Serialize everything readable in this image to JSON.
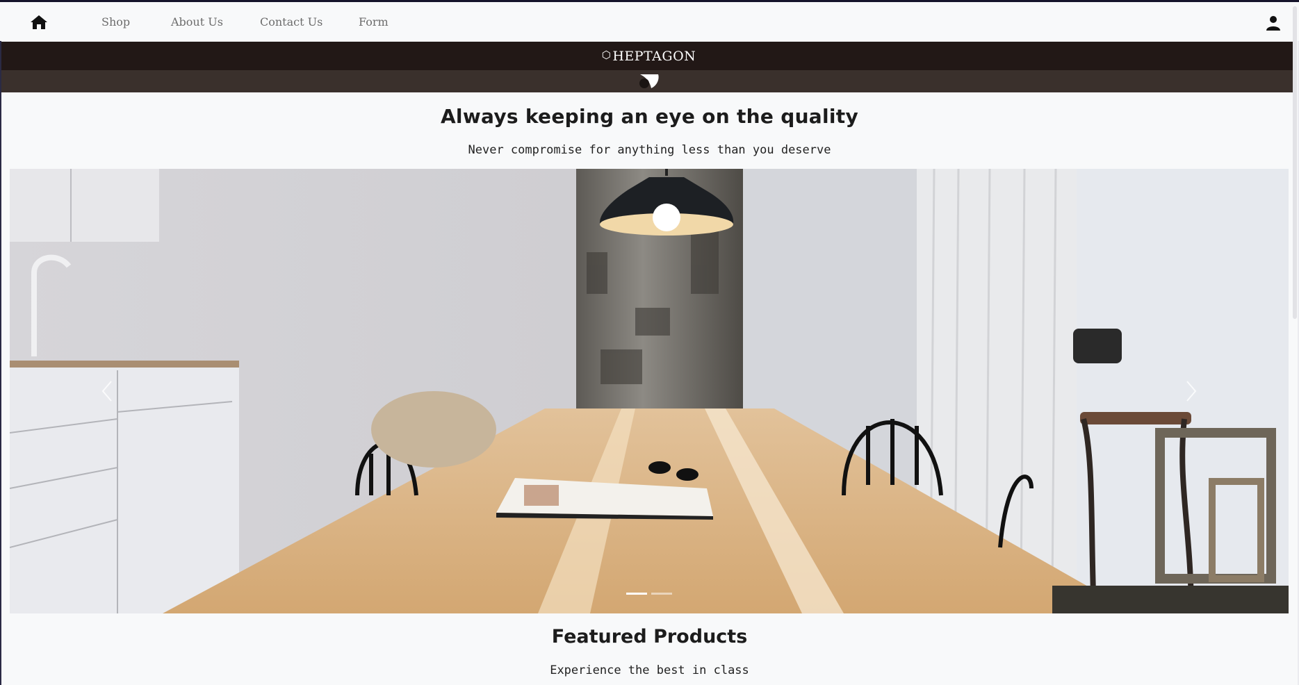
{
  "nav": {
    "links": [
      "Shop",
      "About Us",
      "Contact Us",
      "Form"
    ],
    "home_icon": "home-icon",
    "user_icon": "user-icon"
  },
  "brand": {
    "name": "HEPTAGON",
    "icon": "⬡"
  },
  "hero": {
    "title": "Always keeping an eye on the quality",
    "subtitle": "Never compromise for anything less than you deserve"
  },
  "carousel": {
    "slides": 2,
    "active_index": 0,
    "prev_icon": "chevron-left-icon",
    "next_icon": "chevron-right-icon"
  },
  "featured": {
    "title": "Featured Products",
    "subtitle": "Experience the best in class"
  },
  "colors": {
    "brand_bar": "#221816",
    "toggle_bar": "#3a302c",
    "page_bg": "#f8f9fa",
    "nav_text": "#6c6c6c"
  }
}
